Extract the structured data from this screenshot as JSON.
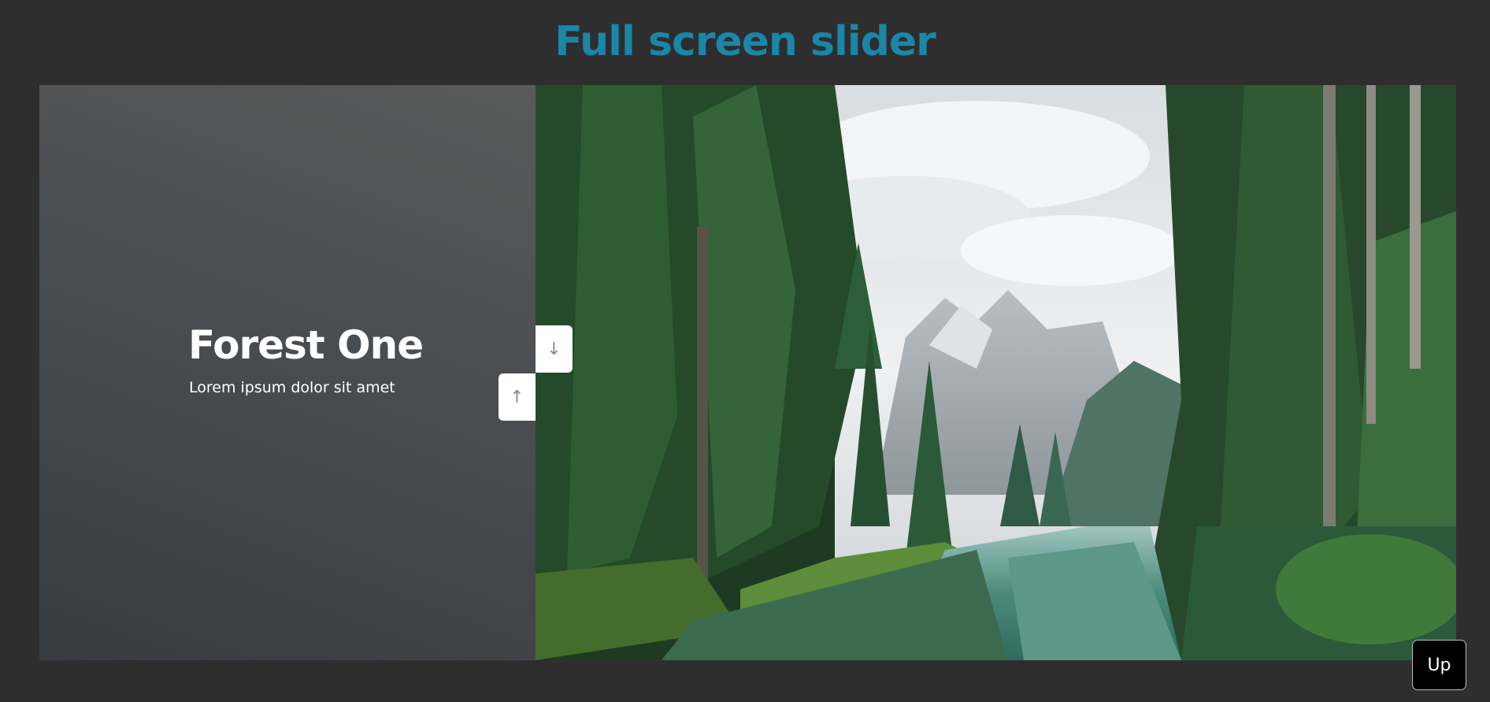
{
  "header": {
    "title": "Full screen slider",
    "title_color": "#1a86a8"
  },
  "slider": {
    "current_slide": {
      "heading": "Forest One",
      "text": "Lorem ipsum dolor sit amet"
    },
    "down_arrow": "↓",
    "up_arrow": "↑"
  },
  "scroll_up_button": {
    "label": "Up"
  },
  "colors": {
    "background": "#2e2e2e",
    "panel_top": "#595a5a",
    "panel_bottom": "#383c40",
    "button_bg": "#ffffff",
    "arrow_color": "#8a8a8a"
  },
  "icons": {
    "down": "arrow-down-icon",
    "up": "arrow-up-icon"
  }
}
